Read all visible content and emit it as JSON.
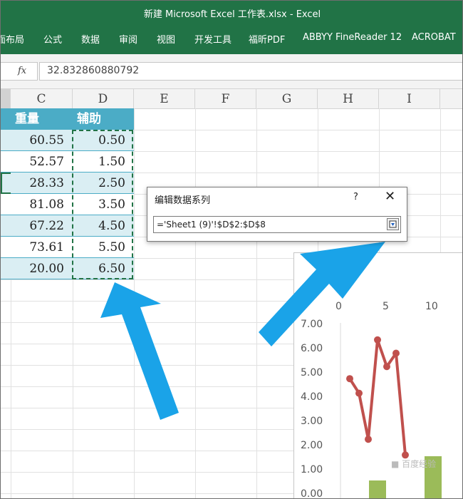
{
  "window": {
    "title": "新建 Microsoft Excel 工作表.xlsx  -  Excel"
  },
  "ribbon": {
    "tabs": [
      "面布局",
      "公式",
      "数据",
      "审阅",
      "视图",
      "开发工具",
      "福昕PDF",
      "ABBYY FineReader 12",
      "ACROBAT"
    ]
  },
  "formula_bar": {
    "fx_label": "fx",
    "value": "32.832860880792"
  },
  "columns": [
    "C",
    "D",
    "E",
    "F",
    "G",
    "H",
    "I"
  ],
  "table": {
    "headers": [
      "重量",
      "辅助"
    ],
    "rows": [
      [
        "60.55",
        "0.50"
      ],
      [
        "52.57",
        "1.50"
      ],
      [
        "28.33",
        "2.50"
      ],
      [
        "81.08",
        "3.50"
      ],
      [
        "67.22",
        "4.50"
      ],
      [
        "73.61",
        "5.50"
      ],
      [
        "20.00",
        "6.50"
      ]
    ]
  },
  "dialog": {
    "title": "编辑数据系列",
    "help": "?",
    "close": "✕",
    "series_value": "='Sheet1 (9)'!$D$2:$D$8",
    "collapse_icon": "collapse-range-icon"
  },
  "chart_data": {
    "type": "line",
    "x_axis_ticks": [
      "0",
      "5",
      "10"
    ],
    "y_axis_ticks": [
      "7.00",
      "6.00",
      "5.00",
      "4.00",
      "3.00",
      "2.00",
      "1.00",
      "0.00"
    ],
    "ylim": [
      0,
      7
    ],
    "line_series": {
      "x": [
        1,
        2,
        3,
        4,
        5,
        6,
        7
      ],
      "values": [
        4.7,
        4.1,
        2.2,
        6.3,
        5.2,
        5.75,
        1.55
      ],
      "color": "#c0504d"
    },
    "bar_series": {
      "x": [
        4,
        10
      ],
      "values": [
        0.5,
        1.5
      ],
      "color": "#9bbb59"
    }
  },
  "colors": {
    "excel_green": "#217346",
    "header_blue": "#4bacc6",
    "cell_light_blue": "#daeef3",
    "arrow_blue": "#1aa3e8"
  },
  "watermark": "■ 百度经验"
}
